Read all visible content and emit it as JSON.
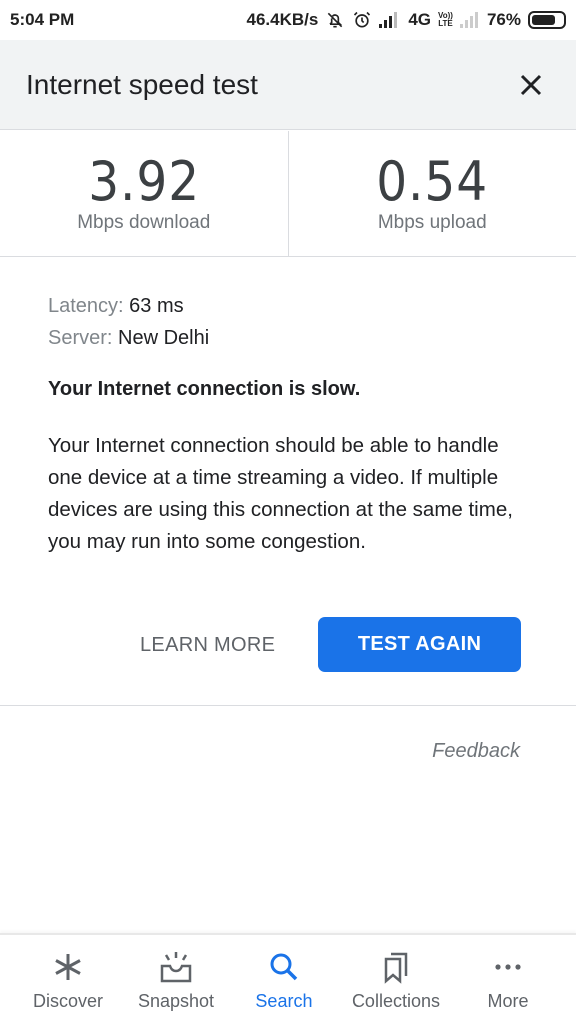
{
  "status_bar": {
    "time": "5:04 PM",
    "network_speed": "46.4KB/s",
    "network_type": "4G",
    "volte_top": "Vo))",
    "volte_bottom": "LTE",
    "battery_percent": "76%",
    "battery_level": 0.76,
    "icons": [
      "notifications-off-icon",
      "alarm-icon",
      "signal-icon",
      "signal-weak-icon",
      "battery-icon"
    ]
  },
  "header": {
    "title": "Internet speed test",
    "close_icon": "close-icon"
  },
  "results": {
    "download": {
      "value": "3.92",
      "label": "Mbps download"
    },
    "upload": {
      "value": "0.54",
      "label": "Mbps upload"
    }
  },
  "details": {
    "latency_key": "Latency:",
    "latency_value": "63 ms",
    "server_key": "Server:",
    "server_value": "New Delhi"
  },
  "verdict": "Your Internet connection is slow.",
  "description": "Your Internet connection should be able to handle one device at a time streaming a video. If multiple devices are using this connection at the same time, you may run into some congestion.",
  "actions": {
    "learn_more": "LEARN MORE",
    "test_again": "TEST AGAIN"
  },
  "feedback": "Feedback",
  "colors": {
    "accent": "#1a73e8",
    "header_bg": "#f1f3f4"
  },
  "bottom_nav": {
    "items": [
      {
        "label": "Discover",
        "icon": "asterisk-icon",
        "active": false
      },
      {
        "label": "Snapshot",
        "icon": "snapshot-icon",
        "active": false
      },
      {
        "label": "Search",
        "icon": "search-icon",
        "active": true
      },
      {
        "label": "Collections",
        "icon": "bookmarks-icon",
        "active": false
      },
      {
        "label": "More",
        "icon": "more-horiz-icon",
        "active": false
      }
    ]
  }
}
